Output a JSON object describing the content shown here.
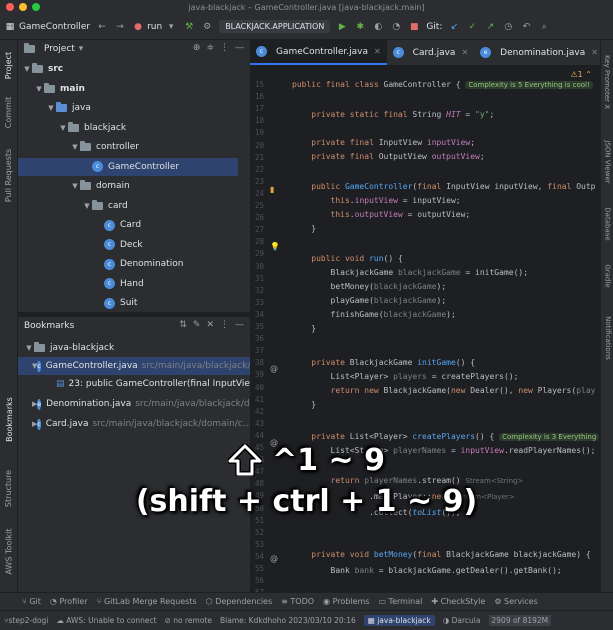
{
  "window": {
    "title": "java-blackjack – GameController.java [java-blackjack.main]"
  },
  "toolbar": {
    "project": "GameController",
    "run": "run",
    "run_config": "BLACKJACK.APPLICATION",
    "git": "Git:"
  },
  "left_tabs": [
    "Project",
    "Commit",
    "Pull Requests",
    "Bookmarks",
    "Structure",
    "AWS Toolkit"
  ],
  "project_panel": {
    "title": "Project",
    "tree": [
      {
        "label": "src",
        "depth": 1,
        "kind": "folder",
        "arrow": "open"
      },
      {
        "label": "main",
        "depth": 2,
        "kind": "folder",
        "arrow": "open"
      },
      {
        "label": "java",
        "depth": 3,
        "kind": "src",
        "arrow": "open"
      },
      {
        "label": "blackjack",
        "depth": 4,
        "kind": "folder",
        "arrow": "open"
      },
      {
        "label": "controller",
        "depth": 5,
        "kind": "folder",
        "arrow": "open"
      },
      {
        "label": "GameController",
        "depth": 6,
        "kind": "class",
        "arrow": "",
        "selected": true
      },
      {
        "label": "domain",
        "depth": 5,
        "kind": "folder",
        "arrow": "open"
      },
      {
        "label": "card",
        "depth": 6,
        "kind": "folder",
        "arrow": "open"
      },
      {
        "label": "Card",
        "depth": 7,
        "kind": "class",
        "arrow": ""
      },
      {
        "label": "Deck",
        "depth": 7,
        "kind": "class",
        "arrow": ""
      },
      {
        "label": "Denomination",
        "depth": 7,
        "kind": "class",
        "arrow": ""
      },
      {
        "label": "Hand",
        "depth": 7,
        "kind": "class",
        "arrow": ""
      },
      {
        "label": "Suit",
        "depth": 7,
        "kind": "class",
        "arrow": ""
      }
    ]
  },
  "bookmarks_panel": {
    "title": "Bookmarks",
    "root": "java-blackjack",
    "items": [
      {
        "file": "GameController.java",
        "path": "src/main/java/blackjack/...",
        "selected": true
      },
      {
        "file": "23: public GameController(final InputView",
        "path": "",
        "sub": true
      },
      {
        "file": "Denomination.java",
        "path": "src/main/java/blackjack/d..."
      },
      {
        "file": "Card.java",
        "path": "src/main/java/blackjack/domain/c..."
      }
    ]
  },
  "editor": {
    "tabs": [
      {
        "label": "GameController.java",
        "active": true
      },
      {
        "label": "Card.java",
        "active": false
      },
      {
        "label": "Denomination.java",
        "active": false
      }
    ],
    "problems_indicator": "⚠1 ⌃",
    "line_numbers": [
      "15",
      "16",
      "17",
      "18",
      "19",
      "20",
      "21",
      "22",
      "23",
      "24",
      "25",
      "26",
      "27",
      "28",
      "29",
      "30",
      "31",
      "32",
      "33",
      "34",
      "35",
      "36",
      "37",
      "38",
      "39",
      "40",
      "41",
      "42",
      "43",
      "44",
      "45",
      "46",
      "47",
      "48",
      "49",
      "50",
      "51",
      "52",
      "53",
      "54",
      "55",
      "56",
      "57",
      "58"
    ],
    "hints": {
      "class_complexity": "Complexity is 5 Everything is cool!",
      "method_complexity": "Complexity is 3 Everything",
      "inlay_stream": "Stream<String>",
      "inlay_player": "Stream<Player>"
    }
  },
  "right_tabs": [
    "Key Promoter X",
    "JSON Viewer",
    "Database",
    "Gradle",
    "Notifications"
  ],
  "tool_windows": [
    "Git",
    "Profiler",
    "GitLab Merge Requests",
    "Dependencies",
    "TODO",
    "Problems",
    "Terminal",
    "CheckStyle",
    "Services"
  ],
  "status_bar": {
    "branch": "step2-dogi",
    "aws": "AWS: Unable to connect",
    "remote": "no remote",
    "blame": "Blame: Kdkdhoho 2023/03/10 20:16",
    "project": "java-blackjack",
    "theme": "Darcula",
    "memory": "2909 of 8192M"
  },
  "overlay": {
    "line1": "^1 ~ 9",
    "line2": "(shift + ctrl + 1 ~ 9)"
  }
}
